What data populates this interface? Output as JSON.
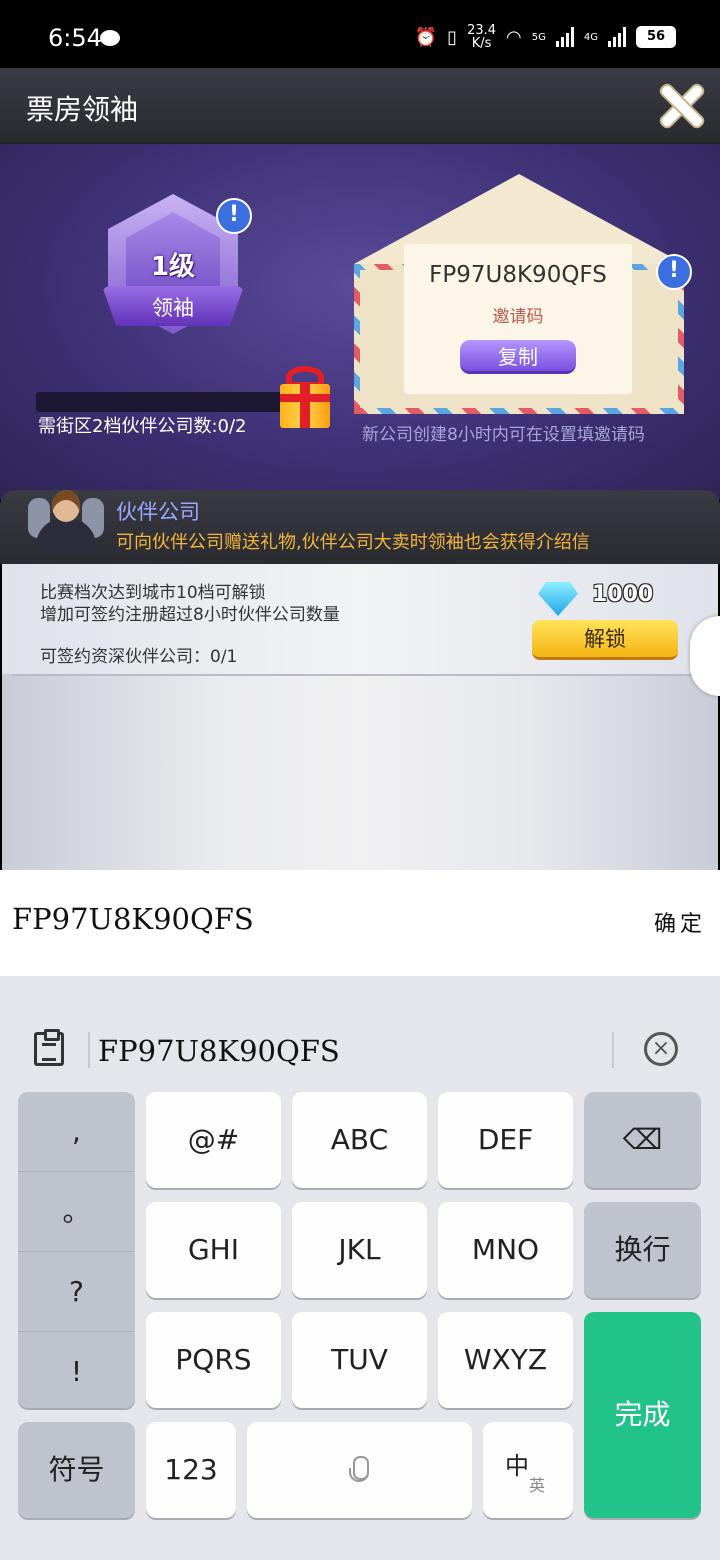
{
  "status_bar": {
    "time": "6:54",
    "speed_top": "23.4",
    "speed_bottom": "K/s",
    "sim1": "5G",
    "sim2": "4G",
    "battery": "56"
  },
  "header": {
    "title": "票房领袖"
  },
  "leader": {
    "level": "1级",
    "title": "领袖",
    "requirement": "需街区2档伙伴公司数:0/2",
    "info_mark": "!"
  },
  "invite": {
    "code": "FP97U8K90QFS",
    "label": "邀请码",
    "copy_label": "复制",
    "note": "新公司创建8小时内可在设置填邀请码",
    "info_mark": "!"
  },
  "partner": {
    "title": "伙伴公司",
    "desc": "可向伙伴公司赠送礼物,伙伴公司大卖时领袖也会获得介绍信",
    "line1": "比赛档次达到城市10档可解锁",
    "line2": "增加可签约注册超过8小时伙伴公司数量",
    "line3": "可签约资深伙伴公司：0/1",
    "diamond_cost": "1000",
    "unlock_label": "解锁"
  },
  "input": {
    "value": "FP97U8K90QFS",
    "confirm_label": "确定"
  },
  "keyboard": {
    "candidate": "FP97U8K90QFS",
    "punct": [
      ",",
      "。",
      "?",
      "!"
    ],
    "row1": [
      "@#",
      "ABC",
      "DEF"
    ],
    "row2": [
      "GHI",
      "JKL",
      "MNO"
    ],
    "row3": [
      "PQRS",
      "TUV",
      "WXYZ"
    ],
    "enter_label": "换行",
    "symbol_label": "符号",
    "num_label": "123",
    "lang_main": "中",
    "lang_sub": "英",
    "done_label": "完成",
    "backspace_symbol": "⌫",
    "clear_symbol": "×"
  }
}
